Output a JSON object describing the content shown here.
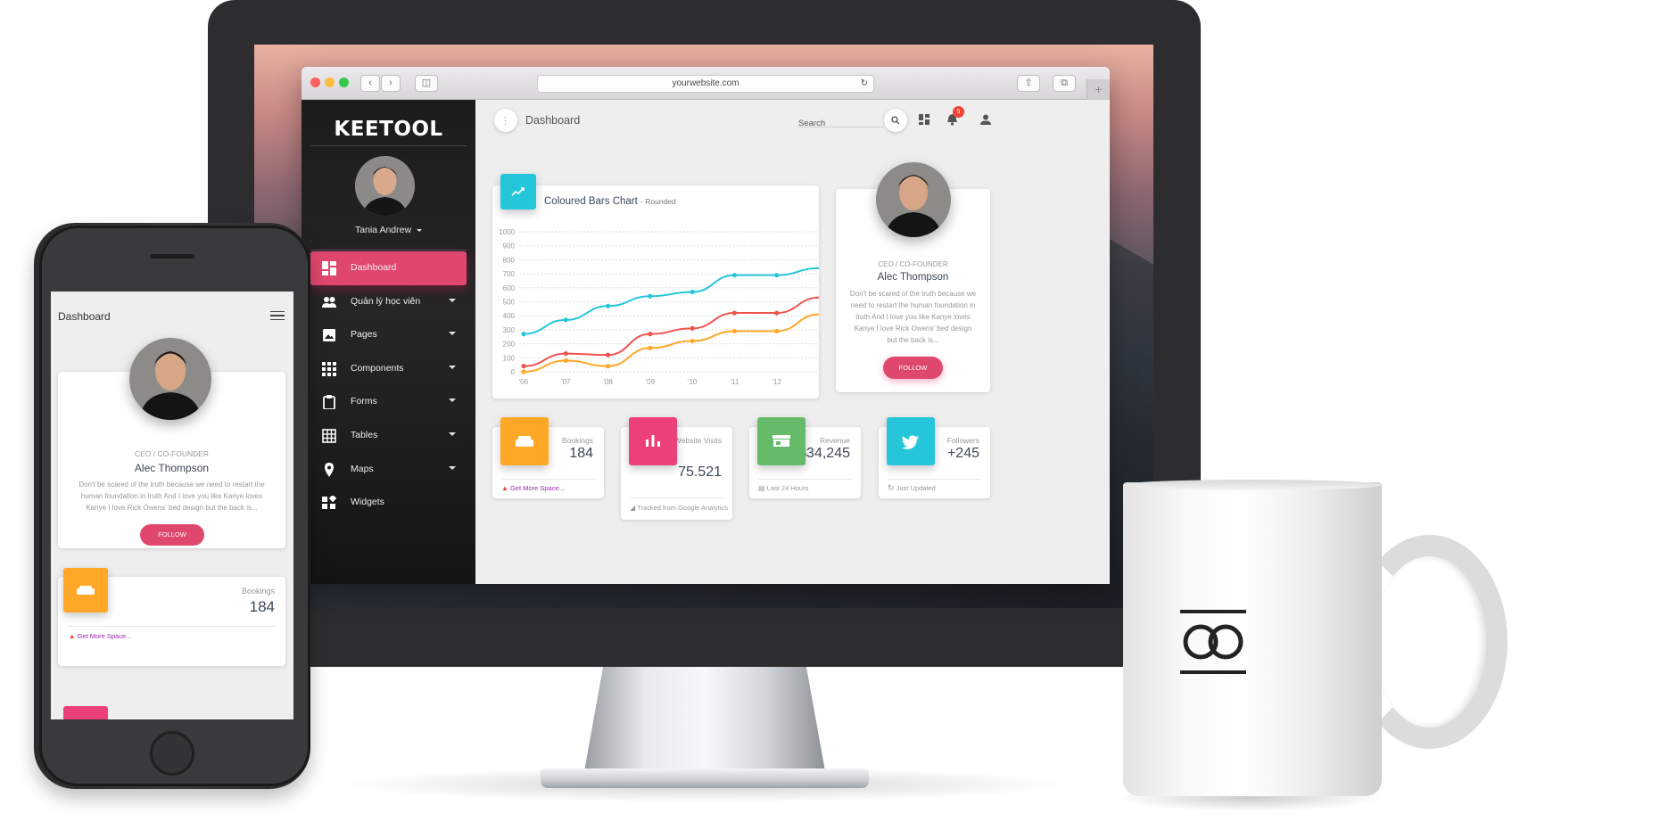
{
  "browser": {
    "url": "yourwebsite.com"
  },
  "sidebar": {
    "logo": "KEETOOL",
    "user_name": "Tania Andrew",
    "items": [
      {
        "label": "Dashboard",
        "icon": "dashboard-icon",
        "active": true,
        "has_caret": false
      },
      {
        "label": "Quản lý học viên",
        "icon": "people-icon",
        "active": false,
        "has_caret": true
      },
      {
        "label": "Pages",
        "icon": "image-icon",
        "active": false,
        "has_caret": true
      },
      {
        "label": "Components",
        "icon": "apps-grid-icon",
        "active": false,
        "has_caret": true
      },
      {
        "label": "Forms",
        "icon": "clipboard-icon",
        "active": false,
        "has_caret": true
      },
      {
        "label": "Tables",
        "icon": "table-grid-icon",
        "active": false,
        "has_caret": true
      },
      {
        "label": "Maps",
        "icon": "map-pin-icon",
        "active": false,
        "has_caret": true
      },
      {
        "label": "Widgets",
        "icon": "widgets-icon",
        "active": false,
        "has_caret": false
      }
    ]
  },
  "topbar": {
    "title": "Dashboard",
    "search_placeholder": "Search",
    "notification_count": "5"
  },
  "chart_card": {
    "title": "Coloured Bars Chart",
    "subtitle": "- Rounded",
    "icon": "trending-up-icon"
  },
  "chart_data": {
    "type": "line",
    "title": "Coloured Bars Chart",
    "subtitle": "- Rounded",
    "x": [
      "'06",
      "'07",
      "'08",
      "'09",
      "'10",
      "'11",
      "'12"
    ],
    "ylim": [
      0,
      1000
    ],
    "yticks": [
      0,
      100,
      200,
      300,
      400,
      500,
      600,
      700,
      800,
      900,
      1000
    ],
    "grid": true,
    "series": [
      {
        "color": "#26c6da",
        "values": [
          270,
          370,
          470,
          540,
          570,
          690,
          690,
          740
        ]
      },
      {
        "color": "#ef5350",
        "values": [
          40,
          130,
          120,
          270,
          310,
          420,
          420,
          530
        ]
      },
      {
        "color": "#ffa726",
        "values": [
          0,
          80,
          40,
          170,
          220,
          290,
          290,
          410
        ]
      }
    ]
  },
  "profile_card": {
    "role": "CEO / CO-FOUNDER",
    "name": "Alec Thompson",
    "bio": "Don't be scared of the truth because we need to restart the human foundation in truth And I love you like Kanye loves Kanye I love Rick Owens' bed design but the back is...",
    "button": "FOLLOW"
  },
  "stats": [
    {
      "label": "Bookings",
      "value": "184",
      "footer": "Get More Space...",
      "color": "#ffa726",
      "icon": "sofa-icon",
      "footer_icon": "warning-icon"
    },
    {
      "label": "Website Visits",
      "value": "75.521",
      "footer": "Tracked from Google Analytics",
      "color": "#ec407a",
      "icon": "bar-chart-icon",
      "footer_icon": "tag-icon"
    },
    {
      "label": "Revenue",
      "value": "$34,245",
      "footer": "Last 24 Hours",
      "color": "#66bb6a",
      "icon": "store-icon",
      "footer_icon": "calendar-icon"
    },
    {
      "label": "Followers",
      "value": "+245",
      "footer": "Just Updated",
      "color": "#26c6da",
      "icon": "twitter-icon",
      "footer_icon": "refresh-icon"
    }
  ],
  "phone": {
    "title": "Dashboard",
    "profile": {
      "role": "CEO / CO-FOUNDER",
      "name": "Alec Thompson",
      "bio": "Don't be scared of the truth because we need to restart the human foundation in truth And I love you like Kanye loves Kanye I love Rick Owens' bed design but the back is...",
      "button": "FOLLOW"
    },
    "stat": {
      "label": "Bookings",
      "value": "184",
      "footer": "Get More Space..."
    }
  }
}
